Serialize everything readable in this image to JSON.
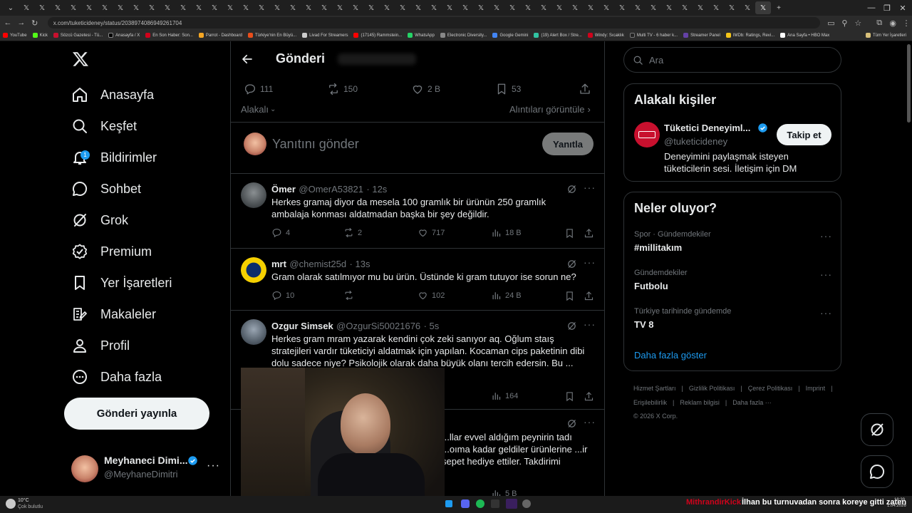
{
  "browser": {
    "url": "x.com/tuketicideney/status/2038974086949261704",
    "bookmarks": [
      "YouTube",
      "Kick",
      "Sözcü Gazetesi - Tü...",
      "Anasayfa / X",
      "En Son Haber: Son...",
      "Parrot - Dashboard",
      "Türkiye'nin En Büyü...",
      "Livad For Streamers",
      "(17145) Rammstein...",
      "WhatsApp",
      "Electronic Diversity...",
      "Google Gemini",
      "(19) Alert Box / Stre...",
      "Windy: Sıcaklık",
      "Multi TV - 6 haber k...",
      "Streamer Panel",
      "IMDb: Ratings, Revi...",
      "Ana Sayfa • HBO Max",
      "Tüm Yer İşaretleri"
    ]
  },
  "sidebar": {
    "items": [
      {
        "label": "Anasayfa",
        "icon": "home-icon"
      },
      {
        "label": "Keşfet",
        "icon": "search-icon"
      },
      {
        "label": "Bildirimler",
        "icon": "bell-icon",
        "badge": "1"
      },
      {
        "label": "Sohbet",
        "icon": "chat-icon"
      },
      {
        "label": "Grok",
        "icon": "grok-icon"
      },
      {
        "label": "Premium",
        "icon": "premium-icon"
      },
      {
        "label": "Yer İşaretleri",
        "icon": "bookmark-icon"
      },
      {
        "label": "Makaleler",
        "icon": "articles-icon"
      },
      {
        "label": "Profil",
        "icon": "profile-icon"
      },
      {
        "label": "Daha fazla",
        "icon": "more-icon"
      }
    ],
    "post_button": "Gönderi yayınla",
    "account": {
      "name": "Meyhaneci Dimi...",
      "handle": "@MeyhaneDimitri"
    }
  },
  "main": {
    "title": "Gönderi",
    "stats": {
      "replies": "111",
      "reposts": "150",
      "likes": "2 B",
      "bookmarks": "53"
    },
    "sort_label": "Alakalı",
    "quotes_label": "Alıntıları görüntüle",
    "reply_placeholder": "Yanıtını gönder",
    "reply_button": "Yanıtla",
    "tweets": [
      {
        "name": "Ömer",
        "handle": "@OmerA53821",
        "time": "· 12s",
        "text": "Herkes gramaj diyor da mesela 100 gramlık bir ürünün 250 gramlık ambalaja konması aldatmadan başka bir şey değildir.",
        "replies": "4",
        "reposts": "2",
        "likes": "717",
        "views": "18 B"
      },
      {
        "name": "mrt",
        "handle": "@chemist25d",
        "time": "· 13s",
        "text": "Gram olarak satılmıyor mu bu ürün. Üstünde ki gram tutuyor ise sorun ne?",
        "replies": "10",
        "reposts": "",
        "likes": "102",
        "views": "24 B"
      },
      {
        "name": "Ozgur Simsek",
        "handle": "@OzgurSi50021676",
        "time": "· 5s",
        "text": "Herkes gram mram yazarak kendini çok zeki sanıyor aq. Oğlum staış stratejileri vardır tüketiciyi aldatmak için yapılan. Kocaman cips paketinin dibi dolu sadece niye? Psikolojik olarak daha büyük olanı tercih edersin. Bu ...",
        "views": "164"
      },
      {
        "text": "...llar evvel aldığım peynirin tadı ...oıma kadar geldiler ürünlerine ...ir sepet hediye ettiler. Takdirimi",
        "views": "5 B"
      }
    ]
  },
  "right": {
    "search_placeholder": "Ara",
    "related": {
      "title": "Alakalı kişiler",
      "name": "Tüketici Deneyiml...",
      "handle": "@tuketicideney",
      "bio": "Deneyimini paylaşmak isteyen tüketicilerin sesi. İletişim için DM",
      "follow_button": "Takip et"
    },
    "trends": {
      "title": "Neler oluyor?",
      "items": [
        {
          "meta": "Spor · Gündemdekiler",
          "name": "#millitakım"
        },
        {
          "meta": "Gündemdekiler",
          "name": "Futbolu"
        },
        {
          "meta": "Türkiye tarihinde gündemde",
          "name": "TV 8"
        }
      ],
      "show_more": "Daha fazla göster"
    },
    "footer": [
      "Hizmet Şartları",
      "Gizlilik Politikası",
      "Çerez Politikası",
      "Imprint",
      "Erişilebilirlik",
      "Reklam bilgisi",
      "Daha fazla ···",
      "© 2026 X Corp."
    ]
  },
  "taskbar": {
    "weather_temp": "10°C",
    "weather_text": "Çok bulutlu",
    "ticker_user": "MithrandirKick",
    "ticker_text": "İlhan bu turnuvadan sonra koreye gitti zaten",
    "time": "18:39",
    "date": "1.04.2026"
  },
  "colors": {
    "accent": "#1d9bf0",
    "background": "#000000",
    "border": "#2f3336",
    "muted": "#71767b",
    "ticker_user": "#d0021b"
  }
}
